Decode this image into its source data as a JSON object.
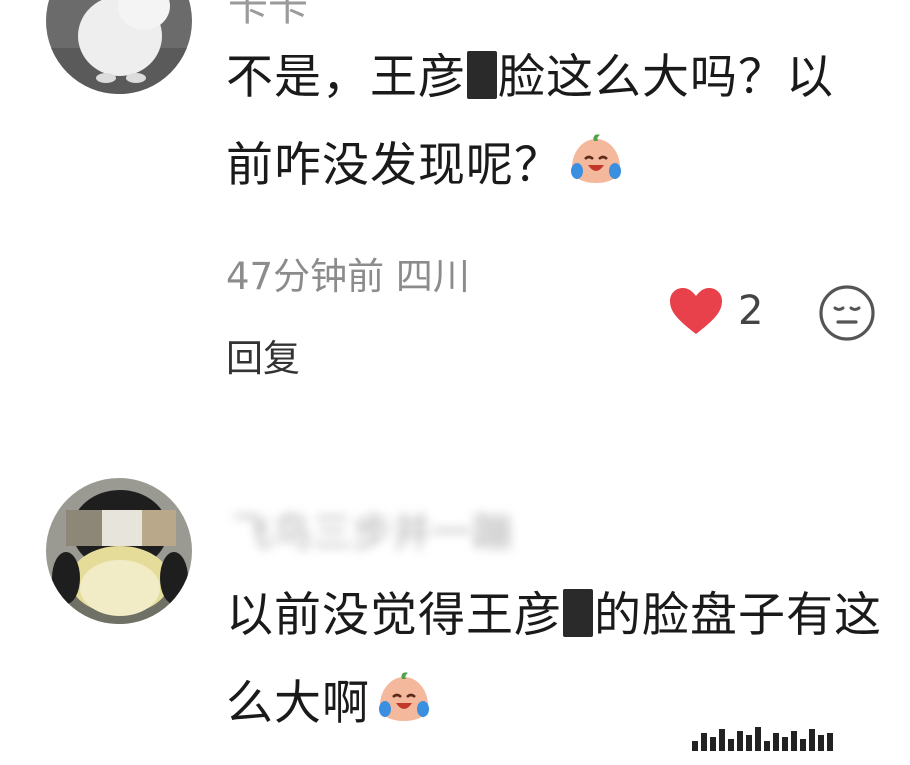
{
  "comments": [
    {
      "username": "卡卡",
      "content_prefix": "不是，王彦",
      "content_suffix": "脸这么大吗？以前咋没发现呢？",
      "emoji": "laugh-cry-emoji",
      "time_location": "47分钟前 四川",
      "reply_label": "回复",
      "like_count": "2",
      "avatar": "white-rabbit-avatar"
    },
    {
      "username": "飞鸟三步并一蹦",
      "content_prefix": "以前没觉得王彦",
      "content_suffix": "的脸盘子有这么大啊",
      "emoji": "laugh-cry-emoji",
      "avatar": "penguin-avatar"
    }
  ],
  "colors": {
    "like_heart": "#e8414b",
    "meta_text": "#8c8c8c",
    "mosaic": "#2a2a2a"
  }
}
